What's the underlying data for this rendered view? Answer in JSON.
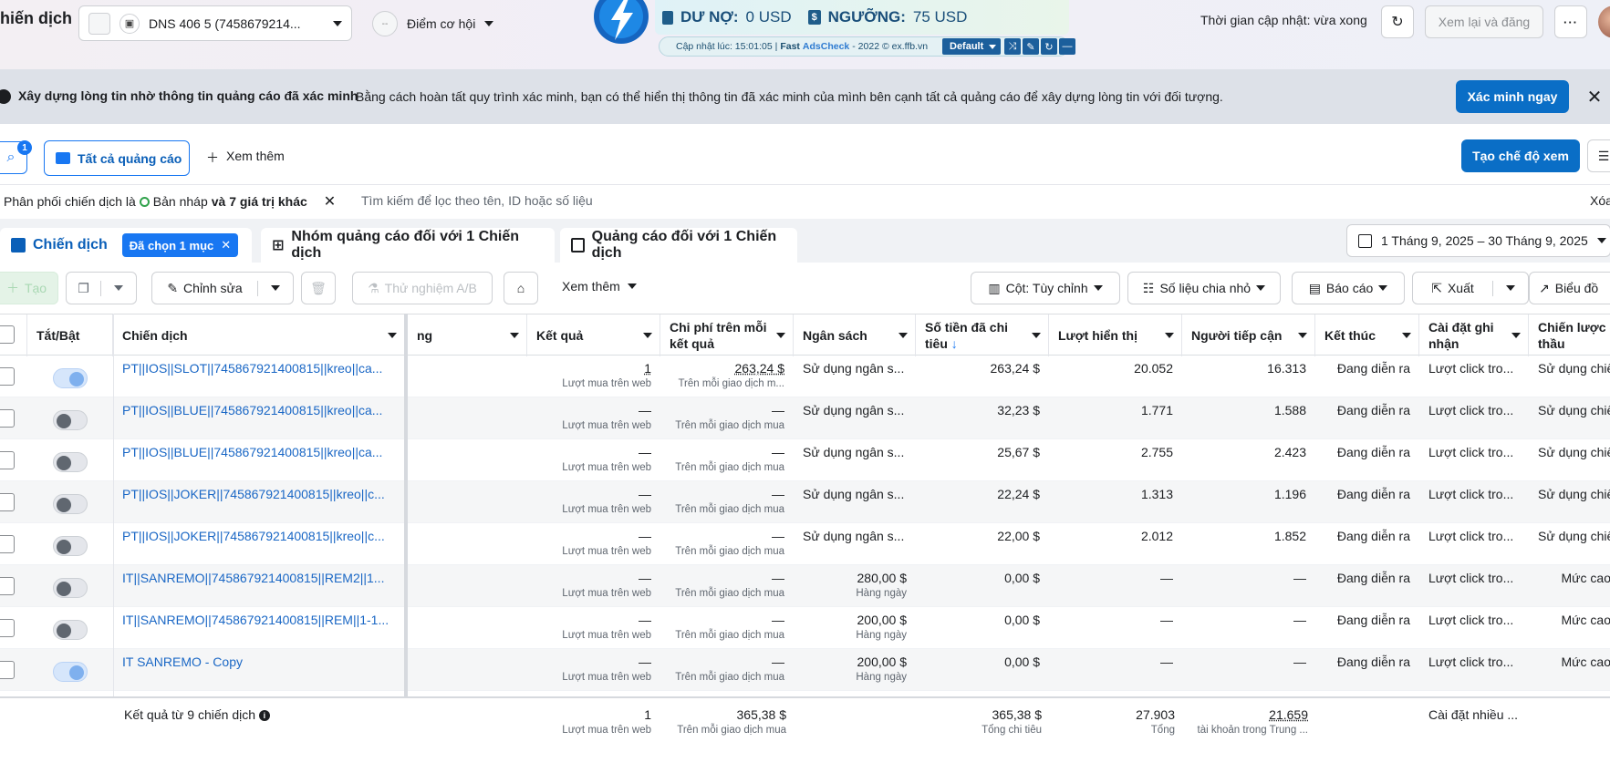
{
  "topbar": {
    "title": "hiến dịch",
    "account_name": "DNS 406 5 (7458679214...",
    "opportunity_label": "Điểm cơ hội",
    "opportunity_icon_text": "--",
    "update_time": "Thời gian cập nhật: vừa xong",
    "review_publish": "Xem lại và đăng"
  },
  "extension": {
    "debt_label": "DƯ NỢ:",
    "debt_value": "0 USD",
    "threshold_label": "NGƯỠNG:",
    "threshold_value": "75 USD",
    "updated_at": "Cập nhật lúc: 15:01:05 |",
    "fast": "Fast",
    "brand": "AdsCheck",
    "copyright": "- 2022 © ex.ffb.vn",
    "profile": "Default"
  },
  "banner": {
    "title": "Xây dựng lòng tin nhờ thông tin quảng cáo đã xác minh",
    "text": "Bằng cách hoàn tất quy trình xác minh, bạn có thể hiển thị thông tin đã xác minh của mình bên cạnh tất cả quảng cáo để xây dựng lòng tin với đối tượng.",
    "verify_button": "Xác minh ngay"
  },
  "toolbar1": {
    "search_badge": "1",
    "all_ads": "Tất cả quảng cáo",
    "see_more": "Xem thêm",
    "create_view": "Tạo chế độ xem"
  },
  "filter": {
    "prefix": "Phân phối chiến dịch là",
    "value": "Bản nháp",
    "extra": "và 7 giá trị khác",
    "placeholder": "Tìm kiếm để lọc theo tên, ID hoặc số liệu",
    "clear": "Xóa"
  },
  "tabs": {
    "campaigns": "Chiến dịch",
    "selected": "Đã chọn 1 mục",
    "adsets": "Nhóm quảng cáo đối với 1 Chiến dịch",
    "ads": "Quảng cáo đối với 1 Chiến dịch",
    "date_range": "1 Tháng 9, 2025 – 30 Tháng 9, 2025"
  },
  "toolbar2": {
    "create": "Tạo",
    "edit": "Chỉnh sửa",
    "ab_test": "Thử nghiệm A/B",
    "see_more": "Xem thêm",
    "columns": "Cột: Tùy chỉnh",
    "breakdown": "Số liệu chia nhỏ",
    "reports": "Báo cáo",
    "export": "Xuất",
    "chart": "Biểu đồ"
  },
  "table": {
    "headers": {
      "toggle": "Tắt/Bật",
      "campaign": "Chiến dịch",
      "delivery": "ng",
      "results": "Kết quả",
      "cost_per_result": "Chi phí trên mỗi kết quả",
      "budget": "Ngân sách",
      "amount_spent": "Số tiền đã chi tiêu",
      "sort_arrow": "↓",
      "impressions": "Lượt hiển thị",
      "reach": "Người tiếp cận",
      "ends": "Kết thúc",
      "attribution": "Cài đặt ghi nhận",
      "bid_strategy": "Chiến lược giá thầu"
    },
    "rows": [
      {
        "on": true,
        "name": "PT||IOS||SLOT||745867921400815||kreo||ca...",
        "result": "1",
        "result_sub": "Lượt mua trên web",
        "cpr": "263,24 $",
        "cpr_sub": "Trên mỗi giao dịch m...",
        "budget": "Sử dụng ngân s...",
        "budget_sub": "",
        "spent": "263,24 $",
        "impr": "20.052",
        "reach": "16.313",
        "ends": "Đang diễn ra",
        "attr": "Lượt click tro...",
        "bid": "Sử dụng chiế"
      },
      {
        "on": false,
        "name": "PT||IOS||BLUE||745867921400815||kreo||ca...",
        "result": "—",
        "result_sub": "Lượt mua trên web",
        "cpr": "—",
        "cpr_sub": "Trên mỗi giao dịch mua",
        "budget": "Sử dụng ngân s...",
        "budget_sub": "",
        "spent": "32,23 $",
        "impr": "1.771",
        "reach": "1.588",
        "ends": "Đang diễn ra",
        "attr": "Lượt click tro...",
        "bid": "Sử dụng chiế"
      },
      {
        "on": false,
        "name": "PT||IOS||BLUE||745867921400815||kreo||ca...",
        "result": "—",
        "result_sub": "Lượt mua trên web",
        "cpr": "—",
        "cpr_sub": "Trên mỗi giao dịch mua",
        "budget": "Sử dụng ngân s...",
        "budget_sub": "",
        "spent": "25,67 $",
        "impr": "2.755",
        "reach": "2.423",
        "ends": "Đang diễn ra",
        "attr": "Lượt click tro...",
        "bid": "Sử dụng chiế"
      },
      {
        "on": false,
        "name": "PT||IOS||JOKER||745867921400815||kreo||c...",
        "result": "—",
        "result_sub": "Lượt mua trên web",
        "cpr": "—",
        "cpr_sub": "Trên mỗi giao dịch mua",
        "budget": "Sử dụng ngân s...",
        "budget_sub": "",
        "spent": "22,24 $",
        "impr": "1.313",
        "reach": "1.196",
        "ends": "Đang diễn ra",
        "attr": "Lượt click tro...",
        "bid": "Sử dụng chiế"
      },
      {
        "on": false,
        "name": "PT||IOS||JOKER||745867921400815||kreo||c...",
        "result": "—",
        "result_sub": "Lượt mua trên web",
        "cpr": "—",
        "cpr_sub": "Trên mỗi giao dịch mua",
        "budget": "Sử dụng ngân s...",
        "budget_sub": "",
        "spent": "22,00 $",
        "impr": "2.012",
        "reach": "1.852",
        "ends": "Đang diễn ra",
        "attr": "Lượt click tro...",
        "bid": "Sử dụng chiế"
      },
      {
        "on": false,
        "name": "IT||SANREMO||745867921400815||REM2||1...",
        "result": "—",
        "result_sub": "Lượt mua trên web",
        "cpr": "—",
        "cpr_sub": "Trên mỗi giao dịch mua",
        "budget": "280,00 $",
        "budget_sub": "Hàng ngày",
        "spent": "0,00 $",
        "impr": "—",
        "reach": "—",
        "ends": "Đang diễn ra",
        "attr": "Lượt click tro...",
        "bid": "Mức cao"
      },
      {
        "on": false,
        "name": "IT||SANREMO||745867921400815||REM||1-1...",
        "result": "—",
        "result_sub": "Lượt mua trên web",
        "cpr": "—",
        "cpr_sub": "Trên mỗi giao dịch mua",
        "budget": "200,00 $",
        "budget_sub": "Hàng ngày",
        "spent": "0,00 $",
        "impr": "—",
        "reach": "—",
        "ends": "Đang diễn ra",
        "attr": "Lượt click tro...",
        "bid": "Mức cao"
      },
      {
        "on": true,
        "name": "IT SANREMO - Copy",
        "result": "—",
        "result_sub": "Lượt mua trên web",
        "cpr": "—",
        "cpr_sub": "Trên mỗi giao dịch mua",
        "budget": "200,00 $",
        "budget_sub": "Hàng ngày",
        "spent": "0,00 $",
        "impr": "—",
        "reach": "—",
        "ends": "Đang diễn ra",
        "attr": "Lượt click tro...",
        "bid": "Mức cao"
      }
    ],
    "footer": {
      "label": "Kết quả từ 9 chiến dịch",
      "result": "1",
      "result_sub": "Lượt mua trên web",
      "cpr": "365,38 $",
      "cpr_sub": "Trên mỗi giao dịch mua",
      "spent": "365,38 $",
      "spent_sub": "Tổng chi tiêu",
      "impr": "27.903",
      "impr_sub": "Tổng",
      "reach": "21.659",
      "reach_sub": "tài khoản trong Trung ...",
      "attr": "Cài đặt nhiều ..."
    }
  }
}
